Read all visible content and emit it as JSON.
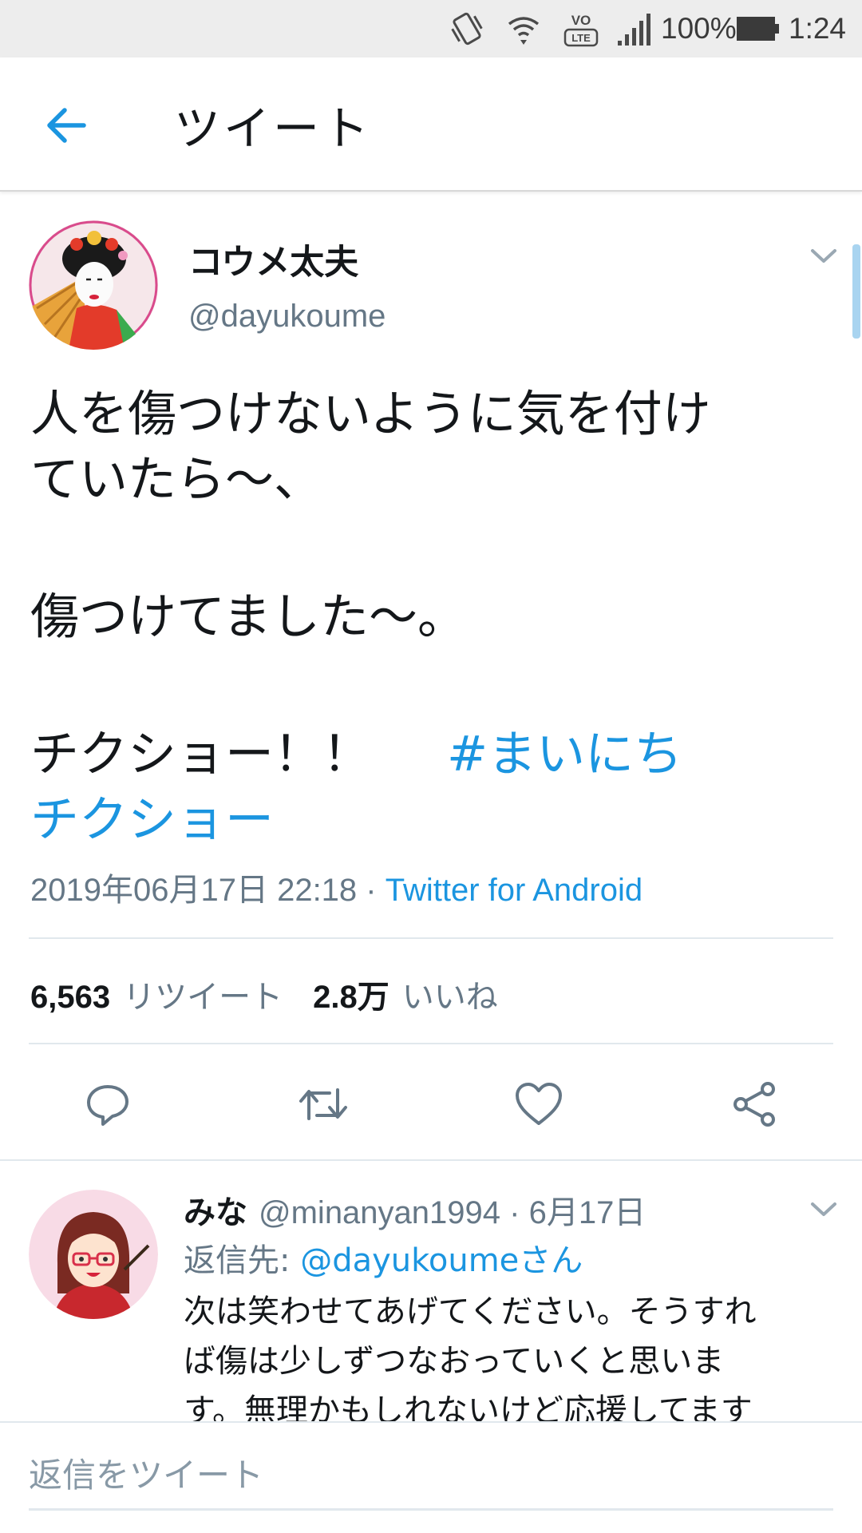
{
  "status_bar": {
    "battery": "100%",
    "time": "1:24",
    "volte_label": "VO",
    "lte_label": "LTE"
  },
  "app_bar": {
    "title": "ツイート",
    "back_icon": "arrow-left-icon"
  },
  "tweet": {
    "author_name": "コウメ太夫",
    "author_handle": "@dayukoume",
    "body_lines": [
      "人を傷つけないように気を付け",
      "ていたら～、",
      "",
      "傷つけてました～。",
      "",
      "チクショー！！　",
      "#まいにち",
      "チクショー"
    ],
    "timestamp": "2019年06月17日 22:18 · ",
    "client": "Twitter for Android",
    "retweet_count": "6,563",
    "retweet_label": "リツイート",
    "like_count": "2.8万",
    "like_label": "いいね",
    "actions": [
      "reply-icon",
      "retweet-icon",
      "like-icon",
      "share-icon"
    ]
  },
  "reply": {
    "name": "みな",
    "handle": "@minanyan1994 · 6月17日",
    "reply_to_prefix": "返信先: ",
    "reply_to_mention": "@dayukoumeさん",
    "body_lines": [
      "次は笑わせてあげてください。そうすれ",
      "ば傷は少しずつなおっていくと思いま",
      "す。無理かもしれないけど応援してます"
    ]
  },
  "compose": {
    "placeholder": "返信をツイート"
  },
  "colors": {
    "accent": "#1b95e0",
    "text_primary": "#14171a",
    "text_secondary": "#657786",
    "divider": "#e1e8ed",
    "status_bar_bg": "#ededed"
  }
}
